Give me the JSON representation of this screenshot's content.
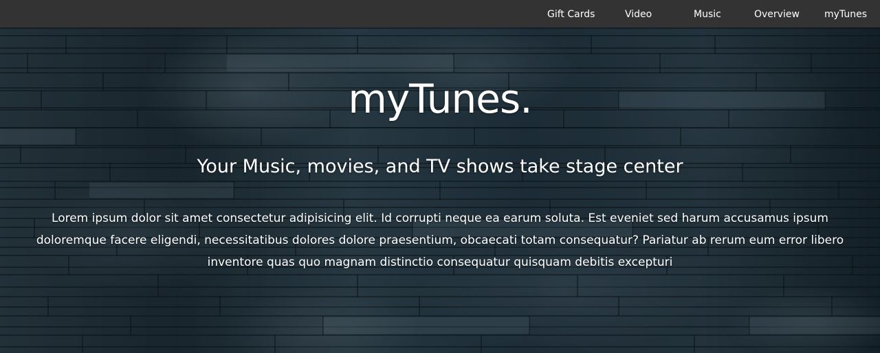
{
  "navbar": {
    "background": "#333333",
    "links": [
      {
        "label": "Gift Cards"
      },
      {
        "label": "Video"
      },
      {
        "label": "Music"
      },
      {
        "label": "Overview"
      },
      {
        "label": "myTunes"
      }
    ]
  },
  "hero": {
    "title": "myTunes.",
    "subtitle": "Your Music, movies, and TV shows take stage center",
    "paragraph": "Lorem ipsum dolor sit amet consectetur adipisicing elit. Id corrupti neque ea earum soluta. Est eveniet sed harum accusamus ipsum doloremque facere eligendi, necessitatibus dolores dolore praesentium, obcaecati totam consequatur? Pariatur ab rerum eum error libero inventore quas quo magnam distinctio consequatur quisquam debitis excepturi",
    "background_description_color": "#1c2a33",
    "text_color": "#ffffff"
  }
}
